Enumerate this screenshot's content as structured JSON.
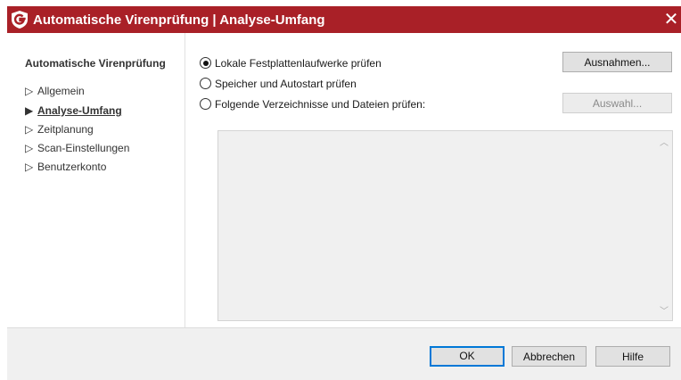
{
  "window": {
    "title": "Automatische Virenprüfung | Analyse-Umfang",
    "close_symbol": "✕",
    "logo_icon": "gdata-shield-icon",
    "accent_color": "#a92027"
  },
  "sidebar": {
    "heading": "Automatische Virenprüfung",
    "items": [
      {
        "label": "Allgemein",
        "active": false
      },
      {
        "label": "Analyse-Umfang",
        "active": true
      },
      {
        "label": "Zeitplanung",
        "active": false
      },
      {
        "label": "Scan-Einstellungen",
        "active": false
      },
      {
        "label": "Benutzerkonto",
        "active": false
      }
    ],
    "arrow_icon": "triangle-right-icon"
  },
  "main": {
    "options": [
      {
        "label": "Lokale Festplattenlaufwerke prüfen",
        "selected": true
      },
      {
        "label": "Speicher und Autostart prüfen",
        "selected": false
      },
      {
        "label": "Folgende Verzeichnisse und Dateien prüfen:",
        "selected": false
      }
    ],
    "exceptions_button": "Ausnahmen...",
    "selection_button": "Auswahl...",
    "selection_button_disabled": true
  },
  "footer": {
    "ok": "OK",
    "cancel": "Abbrechen",
    "help": "Hilfe"
  }
}
